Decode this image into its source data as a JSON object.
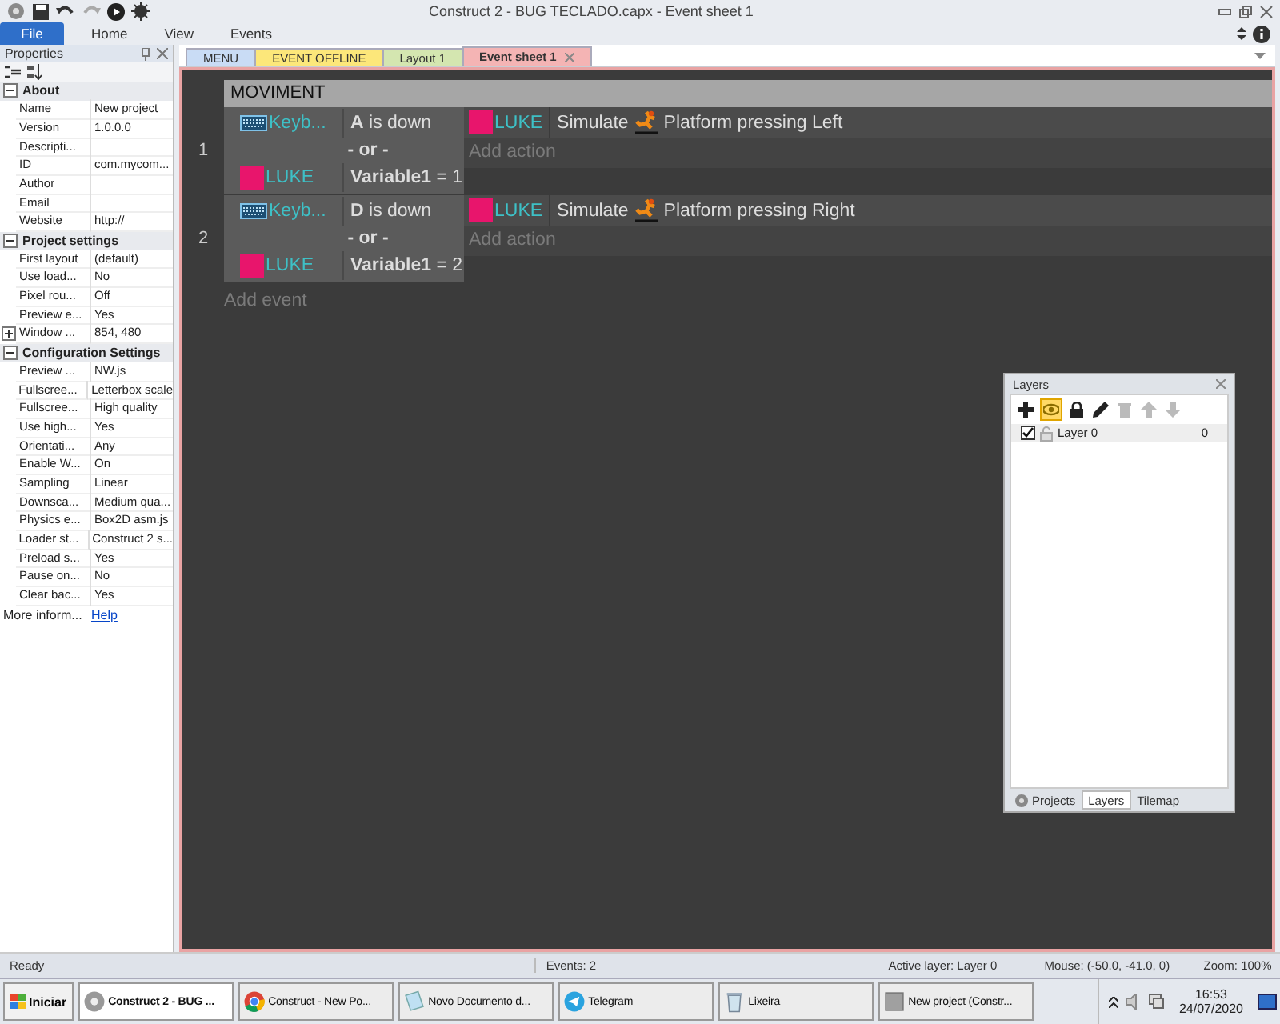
{
  "window": {
    "title": "Construct 2 - BUG TECLADO.capx - Event sheet 1"
  },
  "ribbon_tabs": [
    {
      "label": "File",
      "selected": true
    },
    {
      "label": "Home",
      "selected": false
    },
    {
      "label": "View",
      "selected": false
    },
    {
      "label": "Events",
      "selected": false
    }
  ],
  "properties": {
    "title": "Properties",
    "groups": [
      {
        "title": "About",
        "expanded": true,
        "rows": [
          {
            "name": "Name",
            "value": "New project",
            "kind": "plain"
          },
          {
            "name": "Version",
            "value": "1.0.0.0",
            "kind": "plain"
          },
          {
            "name": "Descripti...",
            "value": "",
            "kind": "plain"
          },
          {
            "name": "ID",
            "value": "com.mycom...",
            "kind": "plain"
          },
          {
            "name": "Author",
            "value": "",
            "kind": "plain"
          },
          {
            "name": "Email",
            "value": "",
            "kind": "plain"
          },
          {
            "name": "Website",
            "value": "http://",
            "kind": "plain"
          }
        ]
      },
      {
        "title": "Project settings",
        "expanded": true,
        "rows": [
          {
            "name": "First layout",
            "value": "(default)",
            "kind": "plain"
          },
          {
            "name": "Use load...",
            "value": "No",
            "kind": "plain"
          },
          {
            "name": "Pixel rou...",
            "value": "Off",
            "kind": "plain"
          },
          {
            "name": "Preview e...",
            "value": "Yes",
            "kind": "plain"
          },
          {
            "name": "Window ...",
            "value": "854, 480",
            "kind": "collapsed"
          }
        ]
      },
      {
        "title": "Configuration Settings",
        "expanded": true,
        "rows": [
          {
            "name": "Preview ...",
            "value": "NW.js",
            "kind": "plain"
          },
          {
            "name": "Fullscree...",
            "value": "Letterbox scale",
            "kind": "plain"
          },
          {
            "name": "Fullscree...",
            "value": "High quality",
            "kind": "plain"
          },
          {
            "name": "Use high...",
            "value": "Yes",
            "kind": "plain"
          },
          {
            "name": "Orientati...",
            "value": "Any",
            "kind": "plain"
          },
          {
            "name": "Enable W...",
            "value": "On",
            "kind": "plain"
          },
          {
            "name": "Sampling",
            "value": "Linear",
            "kind": "plain"
          },
          {
            "name": "Downsca...",
            "value": "Medium qua...",
            "kind": "plain"
          },
          {
            "name": "Physics e...",
            "value": "Box2D asm.js",
            "kind": "plain"
          },
          {
            "name": "Loader st...",
            "value": "Construct 2 s...",
            "kind": "plain"
          },
          {
            "name": "Preload s...",
            "value": "Yes",
            "kind": "plain"
          },
          {
            "name": "Pause on...",
            "value": "No",
            "kind": "plain"
          },
          {
            "name": "Clear bac...",
            "value": "Yes",
            "kind": "plain"
          }
        ]
      }
    ],
    "more_info": {
      "label": "More inform...",
      "link": "Help"
    }
  },
  "doc_tabs": [
    {
      "label": "MENU",
      "color": "#c9dcf5",
      "selected": false
    },
    {
      "label": "EVENT OFFLINE",
      "color": "#fce77a",
      "selected": false
    },
    {
      "label": "Layout 1",
      "color": "#d4e6b0",
      "selected": false
    },
    {
      "label": "Event sheet 1",
      "color": "#f4b4b4",
      "selected": true
    }
  ],
  "event_sheet": {
    "group_title": "MOVIMENT",
    "events": [
      {
        "number": "1",
        "conditions": [
          {
            "kind": "keyboard",
            "object": "Keyb...",
            "text": "**A** is down"
          },
          {
            "kind": "sprite",
            "object": "LUKE",
            "text": "**Variable1** = 1"
          }
        ],
        "or_label": "- or -",
        "actions": [
          {
            "object": "LUKE",
            "verb": "Simulate",
            "text": "Platform pressing Left"
          }
        ],
        "add_action": "Add action"
      },
      {
        "number": "2",
        "conditions": [
          {
            "kind": "keyboard",
            "object": "Keyb...",
            "text": "**D** is down"
          },
          {
            "kind": "sprite",
            "object": "LUKE",
            "text": "**Variable1** = 2"
          }
        ],
        "or_label": "- or -",
        "actions": [
          {
            "object": "LUKE",
            "verb": "Simulate",
            "text": "Platform pressing Right"
          }
        ],
        "add_action": "Add action"
      }
    ],
    "add_event": "Add event"
  },
  "layers_panel": {
    "title": "Layers",
    "tools": [
      {
        "kind": "add",
        "selected": false,
        "disabled": false
      },
      {
        "kind": "eye",
        "selected": true,
        "disabled": false
      },
      {
        "kind": "lock",
        "selected": false,
        "disabled": false
      },
      {
        "kind": "pencil",
        "selected": false,
        "disabled": false
      },
      {
        "kind": "trash",
        "selected": false,
        "disabled": true
      },
      {
        "kind": "up",
        "selected": false,
        "disabled": true
      },
      {
        "kind": "down",
        "selected": false,
        "disabled": true
      }
    ],
    "layers": [
      {
        "name": "Layer 0",
        "number": "0",
        "checked": true
      }
    ],
    "tabs": [
      {
        "label": "Projects",
        "selected": false
      },
      {
        "label": "Layers",
        "selected": true
      },
      {
        "label": "Tilemap",
        "selected": false
      }
    ]
  },
  "status_bar": [
    "Ready",
    "Events: 2",
    "Active layer: Layer 0",
    "Mouse: (-50.0, -41.0, 0)",
    "Zoom: 100%"
  ],
  "taskbar": {
    "start": "Iniciar",
    "items": [
      {
        "kind": "gear",
        "label": "Construct 2 - BUG ...",
        "selected": true
      },
      {
        "kind": "browser",
        "label": "Construct - New Po...",
        "selected": false
      },
      {
        "kind": "notepad",
        "label": "Novo Documento d...",
        "selected": false
      },
      {
        "kind": "telegram",
        "label": "Telegram",
        "selected": false
      },
      {
        "kind": "bin",
        "label": "Lixeira",
        "selected": false
      },
      {
        "kind": "window",
        "label": "New project (Constr...",
        "selected": false
      }
    ],
    "time": "16:53",
    "date": "24/07/2020"
  }
}
